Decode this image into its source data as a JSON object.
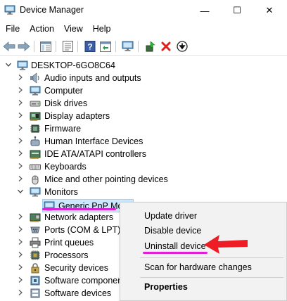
{
  "window": {
    "title": "Device Manager",
    "min_glyph": "—",
    "max_glyph": "☐",
    "close_glyph": "✕"
  },
  "menu": [
    "File",
    "Action",
    "View",
    "Help"
  ],
  "tree": {
    "root": "DESKTOP-6GO8C64",
    "items": [
      {
        "label": "Audio inputs and outputs",
        "icon": "speaker-icon",
        "expanded": false
      },
      {
        "label": "Computer",
        "icon": "monitor-icon",
        "expanded": false
      },
      {
        "label": "Disk drives",
        "icon": "disk-drive-icon",
        "expanded": false
      },
      {
        "label": "Display adapters",
        "icon": "display-adapter-icon",
        "expanded": false
      },
      {
        "label": "Firmware",
        "icon": "firmware-icon",
        "expanded": false
      },
      {
        "label": "Human Interface Devices",
        "icon": "hid-icon",
        "expanded": false
      },
      {
        "label": "IDE ATA/ATAPI controllers",
        "icon": "ide-controller-icon",
        "expanded": false
      },
      {
        "label": "Keyboards",
        "icon": "keyboard-icon",
        "expanded": false
      },
      {
        "label": "Mice and other pointing devices",
        "icon": "mouse-icon",
        "expanded": false
      },
      {
        "label": "Monitors",
        "icon": "monitor-icon",
        "expanded": true
      },
      {
        "label": "Network adapters",
        "icon": "network-adapter-icon",
        "expanded": false
      },
      {
        "label": "Ports (COM & LPT)",
        "icon": "port-icon",
        "expanded": false
      },
      {
        "label": "Print queues",
        "icon": "printer-icon",
        "expanded": false
      },
      {
        "label": "Processors",
        "icon": "processor-icon",
        "expanded": false
      },
      {
        "label": "Security devices",
        "icon": "security-device-icon",
        "expanded": false
      },
      {
        "label": "Software componen",
        "icon": "software-component-icon",
        "expanded": false
      },
      {
        "label": "Software devices",
        "icon": "software-device-icon",
        "expanded": false
      }
    ],
    "selected_child": "Generic PnP Monitor"
  },
  "context_menu": {
    "items": [
      "Update driver",
      "Disable device",
      "Uninstall device",
      "Scan for hardware changes",
      "Properties"
    ]
  },
  "colors": {
    "selection": "#cce8ff",
    "annotation": "#e020d6",
    "arrow": "#ee1c24"
  }
}
